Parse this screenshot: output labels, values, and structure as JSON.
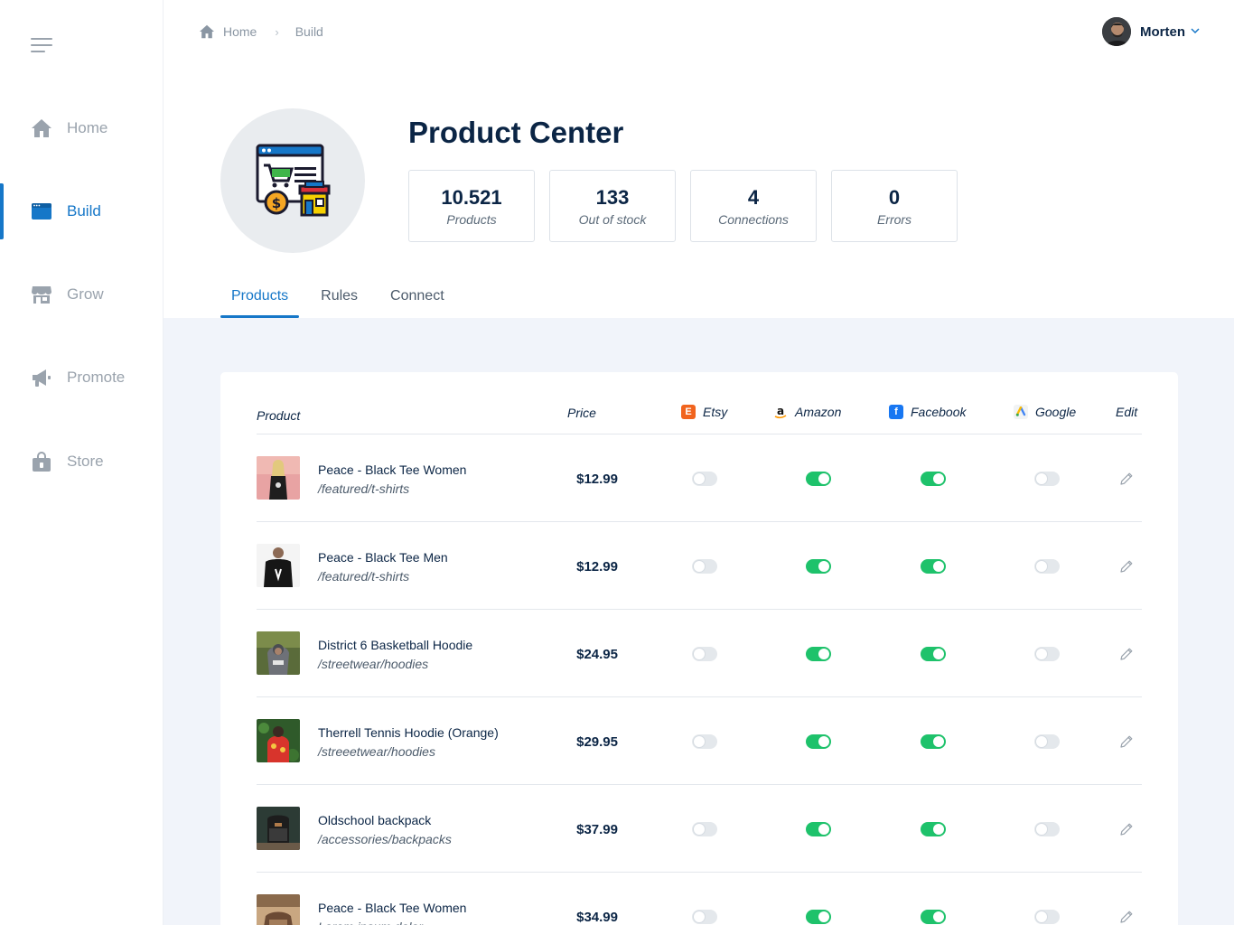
{
  "sidebar": {
    "items": [
      {
        "label": "Home",
        "icon": "home-icon"
      },
      {
        "label": "Build",
        "icon": "browser-window-icon",
        "active": true
      },
      {
        "label": "Grow",
        "icon": "storefront-icon"
      },
      {
        "label": "Promote",
        "icon": "megaphone-icon"
      },
      {
        "label": "Store",
        "icon": "shopping-bag-icon"
      }
    ]
  },
  "breadcrumb": {
    "home": "Home",
    "current": "Build"
  },
  "user": {
    "name": "Morten"
  },
  "page": {
    "title": "Product Center"
  },
  "stats": [
    {
      "value": "10.521",
      "label": "Products"
    },
    {
      "value": "133",
      "label": "Out of stock"
    },
    {
      "value": "4",
      "label": "Connections"
    },
    {
      "value": "0",
      "label": "Errors"
    }
  ],
  "tabs": [
    {
      "label": "Products",
      "active": true
    },
    {
      "label": "Rules"
    },
    {
      "label": "Connect"
    }
  ],
  "table": {
    "headers": {
      "product": "Product",
      "price": "Price",
      "etsy": "Etsy",
      "amazon": "Amazon",
      "facebook": "Facebook",
      "google": "Google",
      "edit": "Edit"
    },
    "rows": [
      {
        "name": "Peace - Black Tee Women",
        "path": "/featured/t-shirts",
        "price": "$12.99",
        "etsy": false,
        "amazon": true,
        "facebook": true,
        "google": false
      },
      {
        "name": "Peace - Black Tee Men",
        "path": "/featured/t-shirts",
        "price": "$12.99",
        "etsy": false,
        "amazon": true,
        "facebook": true,
        "google": false
      },
      {
        "name": "District 6 Basketball Hoodie",
        "path": "/streetwear/hoodies",
        "price": "$24.95",
        "etsy": false,
        "amazon": true,
        "facebook": true,
        "google": false
      },
      {
        "name": "Therrell Tennis Hoodie (Orange)",
        "path": "/streeetwear/hoodies",
        "price": "$29.95",
        "etsy": false,
        "amazon": true,
        "facebook": true,
        "google": false
      },
      {
        "name": "Oldschool backpack",
        "path": "/accessories/backpacks",
        "price": "$37.99",
        "etsy": false,
        "amazon": true,
        "facebook": true,
        "google": false
      },
      {
        "name": "Peace - Black Tee Women",
        "path": "Lorem ipsum dolor",
        "price": "$34.99",
        "etsy": false,
        "amazon": true,
        "facebook": true,
        "google": false
      }
    ]
  },
  "colors": {
    "accent": "#1677c8",
    "toggle_on": "#1ec26b",
    "text_dark": "#0b2545"
  }
}
